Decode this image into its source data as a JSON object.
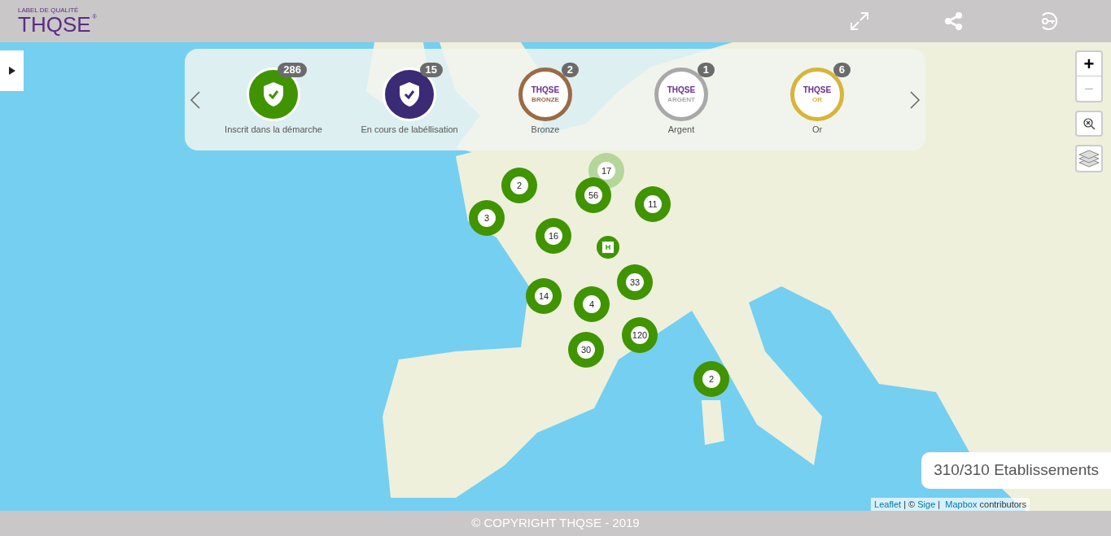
{
  "header": {
    "logo": {
      "tagline": "LABEL DE QUALITÉ",
      "name": "THQSE",
      "mark": "®"
    }
  },
  "legend": {
    "items": [
      {
        "kind": "shield",
        "color": "#3f9400",
        "count": "286",
        "label": "Inscrit dans la démarche"
      },
      {
        "kind": "shield",
        "color": "#3b2a74",
        "count": "15",
        "label": "En cours de labéllisation"
      },
      {
        "kind": "medal",
        "color": "#9a6b45",
        "count": "2",
        "label": "Bronze",
        "medal_logo": "THQSE",
        "medal_text": "BRONZE"
      },
      {
        "kind": "medal",
        "color": "#a8a8a8",
        "count": "1",
        "label": "Argent",
        "medal_logo": "THQSE",
        "medal_text": "ARGENT"
      },
      {
        "kind": "medal",
        "color": "#d9b43a",
        "count": "6",
        "label": "Or",
        "medal_logo": "THQSE",
        "medal_text": "OR"
      }
    ]
  },
  "clusters": [
    {
      "kind": "cluster",
      "count": "17",
      "faded": true
    },
    {
      "kind": "cluster",
      "count": "2",
      "faded": false
    },
    {
      "kind": "cluster",
      "count": "56",
      "faded": false
    },
    {
      "kind": "cluster",
      "count": "11",
      "faded": false
    },
    {
      "kind": "cluster",
      "count": "3",
      "faded": false
    },
    {
      "kind": "cluster",
      "count": "16",
      "faded": false
    },
    {
      "kind": "single",
      "count": "H",
      "faded": false
    },
    {
      "kind": "cluster",
      "count": "33",
      "faded": false
    },
    {
      "kind": "cluster",
      "count": "14",
      "faded": false
    },
    {
      "kind": "cluster",
      "count": "4",
      "faded": false
    },
    {
      "kind": "cluster",
      "count": "120",
      "faded": false
    },
    {
      "kind": "cluster",
      "count": "30",
      "faded": false
    },
    {
      "kind": "cluster",
      "count": "2",
      "faded": false
    }
  ],
  "zoom": {
    "in": "+",
    "out": "−"
  },
  "total": "310/310 Etablissements",
  "attribution": [
    {
      "text": "Leaflet",
      "link": true
    },
    {
      "text": " | © ",
      "link": false
    },
    {
      "text": "Sige",
      "link": true
    },
    {
      "text": " |  ",
      "link": false
    },
    {
      "text": "Mapbox",
      "link": true
    },
    {
      "text": " contributors",
      "link": false
    }
  ],
  "footer": "© COPYRIGHT THQSE - 2019"
}
